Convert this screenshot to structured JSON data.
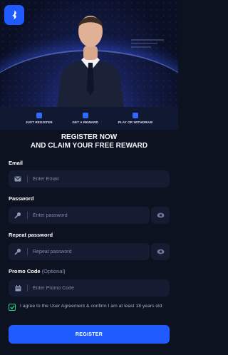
{
  "steps": [
    {
      "label": "JUST REGISTER",
      "icon": "user-icon"
    },
    {
      "label": "GET A REWARD",
      "icon": "gift-icon"
    },
    {
      "label": "PLAY OR WITHDRAW",
      "icon": "wallet-icon"
    }
  ],
  "headline": {
    "line1": "REGISTER NOW",
    "line2": "AND CLAIM YOUR FREE REWARD"
  },
  "email": {
    "label": "Email",
    "placeholder": "Enter Email",
    "icon": "envelope-icon"
  },
  "password": {
    "label": "Password",
    "placeholder": "Enter password",
    "icon": "key-icon"
  },
  "repeat_password": {
    "label": "Repeat password",
    "placeholder": "Repeat password",
    "icon": "key-icon"
  },
  "promo": {
    "label": "Promo Code",
    "optional": "(Optional)",
    "placeholder": "Enter Promo Code",
    "icon": "calendar-icon"
  },
  "agreement": {
    "text": "I agree to the User Agreement & confirm I am at least 18 years old",
    "checked": true
  },
  "register_button": "REGISTER",
  "colors": {
    "accent": "#1f5bff",
    "check": "#2bd18b",
    "background": "#0d1220",
    "field": "#151b30"
  }
}
